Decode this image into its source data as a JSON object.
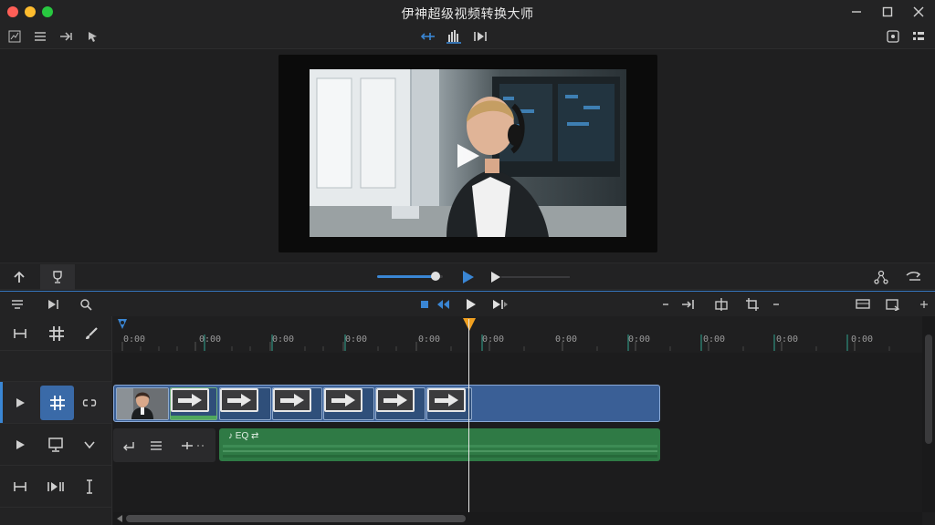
{
  "window": {
    "title": "伊神超级视频转换大师"
  },
  "colors": {
    "accent": "#3a86d4",
    "playhead": "#f0a020",
    "video_clip": "#3a5f96",
    "audio_clip": "#2f7a45"
  },
  "toolbar": {
    "left_icons": [
      "chart-icon",
      "list-icon",
      "arrow-right-icon",
      "cursor-icon"
    ],
    "center_icons": [
      "fit-icon",
      "waveform-icon",
      "skip-icon"
    ],
    "right_icons": [
      "snapshot-icon",
      "grid-icon"
    ]
  },
  "playback": {
    "volume_fraction": 0.89,
    "progress_fraction": 0.0
  },
  "ruler": {
    "tick_label": "0:00"
  },
  "audio_clip": {
    "label": "♪ EQ ⇄"
  }
}
